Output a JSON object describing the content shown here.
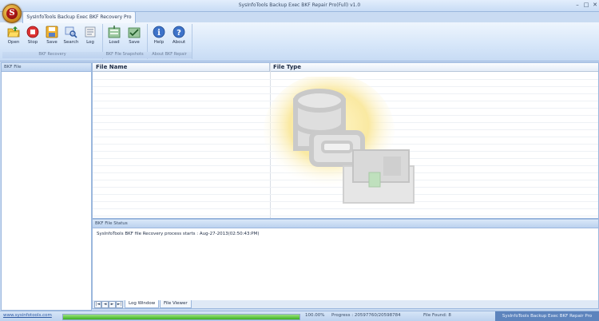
{
  "window": {
    "title": "SysInfoTools Backup Exec BKF Repair Pro(Full) v1.0",
    "controls": [
      "–",
      "□",
      "✕"
    ]
  },
  "ribbon": {
    "tab_label": "SysInfoTools Backup Exec BKF Recovery Pro",
    "groups": [
      {
        "label": "BKF Recovery",
        "buttons": [
          {
            "label": "Open",
            "icon": "folder-open-icon"
          },
          {
            "label": "Stop",
            "icon": "stop-icon"
          },
          {
            "label": "Save",
            "icon": "save-icon"
          },
          {
            "label": "Search",
            "icon": "search-icon"
          },
          {
            "label": "Log",
            "icon": "log-icon"
          }
        ]
      },
      {
        "label": "BKF File Snapshots",
        "buttons": [
          {
            "label": "Load",
            "icon": "load-icon"
          },
          {
            "label": "Save",
            "icon": "save-snapshot-icon"
          }
        ]
      },
      {
        "label": "About BKF Repair",
        "buttons": [
          {
            "label": "Help",
            "icon": "help-icon"
          },
          {
            "label": "About",
            "icon": "about-icon"
          }
        ]
      }
    ]
  },
  "left_panel": {
    "header": "BKF File"
  },
  "file_table": {
    "columns": [
      "File Name",
      "File Type"
    ]
  },
  "status_panel": {
    "header": "BKF File Status",
    "message": "SysInfoTools BKF file Recovery process starts : Aug-27-2013(02:50:43:PM)"
  },
  "bottom_tabs": [
    "Log Window",
    "File Viewer"
  ],
  "nav_buttons": [
    "|◄",
    "◄",
    "►",
    "►|"
  ],
  "statusbar": {
    "link": "www.sysinfotools.com",
    "progress_pct": 100,
    "progress_text": "100.00%",
    "progress_label": "Progress : 20597760/20598784",
    "files_found": "File Found: 8",
    "brand": "SysInfoTools Backup Exec BKF Repair Pro"
  }
}
